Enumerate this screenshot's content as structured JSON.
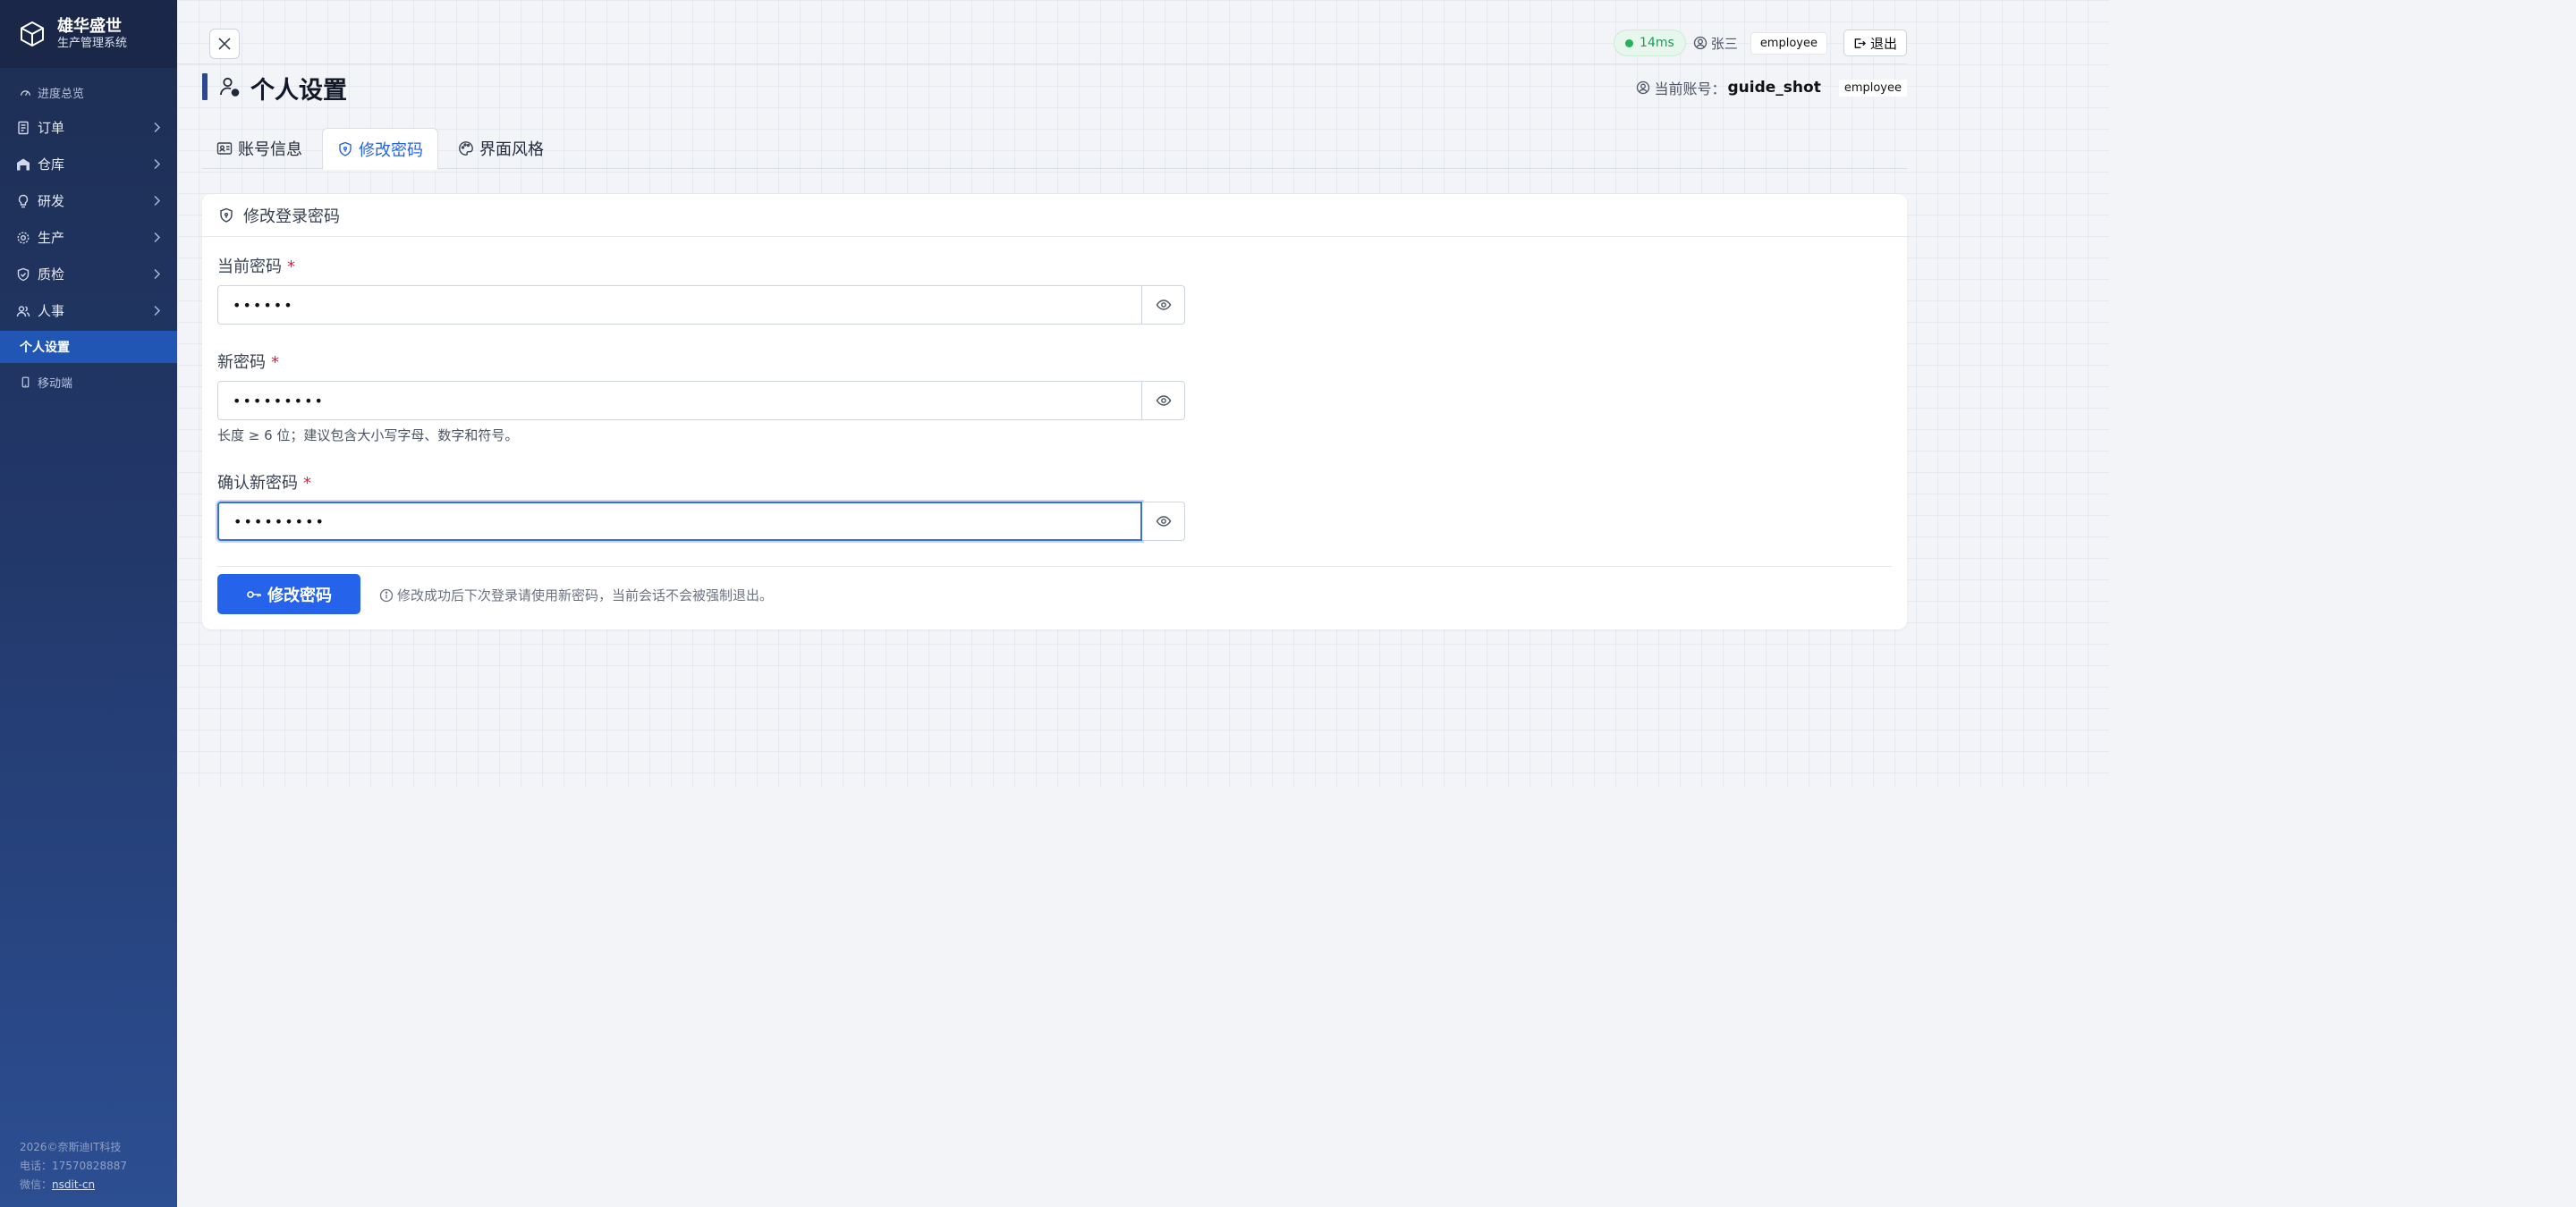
{
  "brand": {
    "title": "雄华盛世",
    "subtitle": "生产管理系统"
  },
  "sidebar": {
    "items": [
      {
        "label": "进度总览",
        "icon": "speedometer-icon"
      },
      {
        "label": "订单",
        "icon": "receipt-icon"
      },
      {
        "label": "仓库",
        "icon": "warehouse-icon"
      },
      {
        "label": "研发",
        "icon": "lightbulb-icon"
      },
      {
        "label": "生产",
        "icon": "gear-icon"
      },
      {
        "label": "质检",
        "icon": "shield-check-icon"
      },
      {
        "label": "人事",
        "icon": "people-icon"
      },
      {
        "label": "个人设置",
        "icon": ""
      },
      {
        "label": "移动端",
        "icon": "phone-icon"
      }
    ],
    "active_index": 7,
    "footer": {
      "copyright": "2026©奈斯迪IT科技",
      "phone": "电话：17570828887",
      "wechat_prefix": "微信：",
      "wechat_id": "nsdit-cn"
    }
  },
  "topbar": {
    "latency": "14ms",
    "user_name": "张三",
    "role": "employee",
    "logout_label": "退出"
  },
  "page": {
    "title": "个人设置",
    "account_prefix": "当前账号：",
    "account_name": "guide_shot",
    "account_role": "employee"
  },
  "tabs": [
    {
      "label": "账号信息",
      "icon": "id-card-icon"
    },
    {
      "label": "修改密码",
      "icon": "shield-lock-icon"
    },
    {
      "label": "界面风格",
      "icon": "palette-icon"
    }
  ],
  "active_tab": 1,
  "form": {
    "card_title": "修改登录密码",
    "current": {
      "label": "当前密码",
      "required": "*",
      "value": "••••••"
    },
    "new": {
      "label": "新密码",
      "required": "*",
      "value": "•••••••••",
      "help": "长度 ≥ 6 位；建议包含大小写字母、数字和符号。"
    },
    "confirm": {
      "label": "确认新密码",
      "required": "*",
      "value": "•••••••••"
    },
    "submit_label": "修改密码",
    "hint": "修改成功后下次登录请使用新密码，当前会话不会被强制退出。"
  },
  "colors": {
    "primary": "#2563eb",
    "sidebar": "#22386a",
    "required": "#e11d48",
    "status_ok": "#22b45a"
  }
}
